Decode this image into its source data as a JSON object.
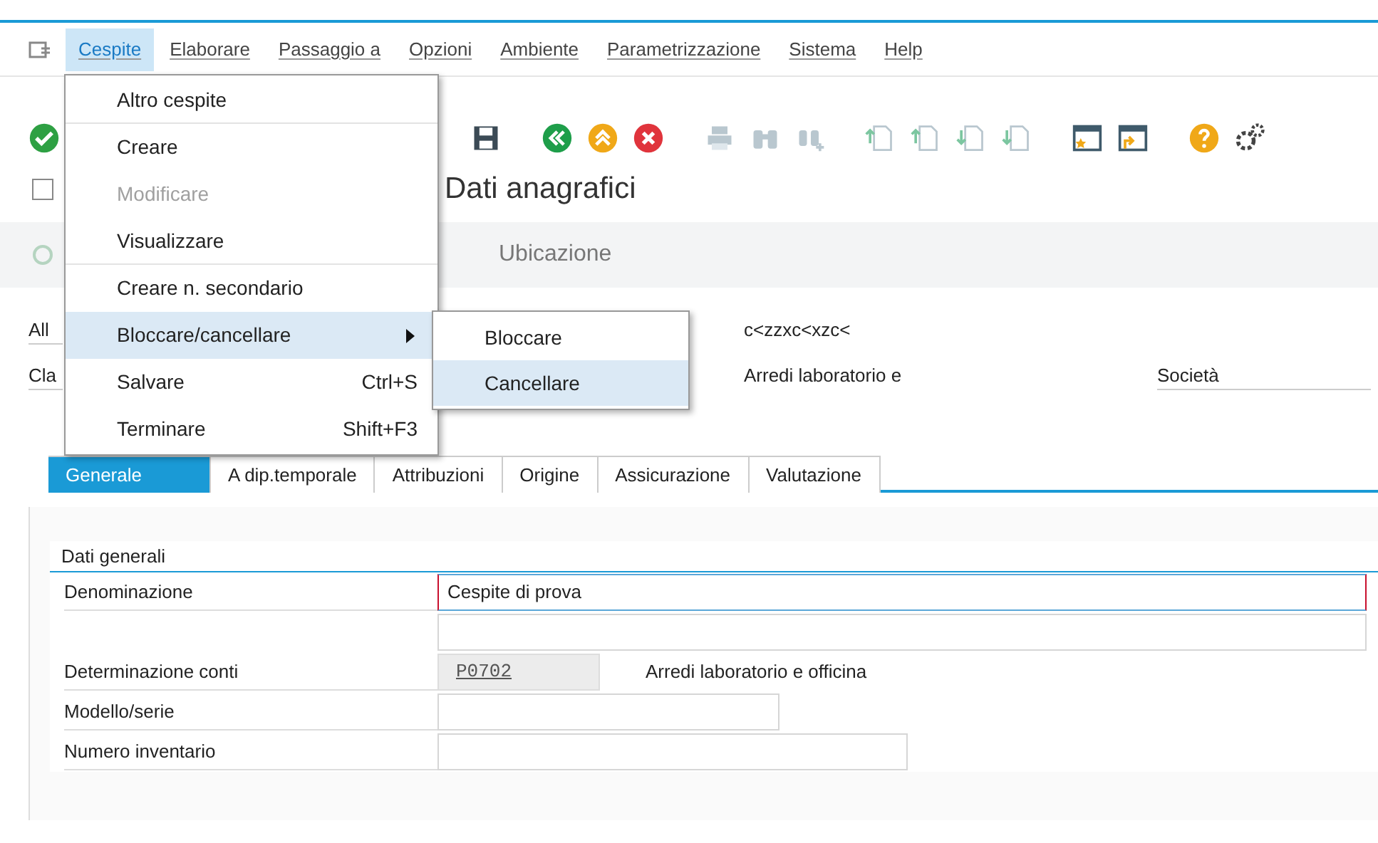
{
  "menubar": [
    {
      "label": "Cespite",
      "selected": true
    },
    {
      "label": "Elaborare",
      "selected": false
    },
    {
      "label": "Passaggio a",
      "selected": false
    },
    {
      "label": "Opzioni",
      "selected": false
    },
    {
      "label": "Ambiente",
      "selected": false
    },
    {
      "label": "Parametrizzazione",
      "selected": false
    },
    {
      "label": "Sistema",
      "selected": false
    },
    {
      "label": "Help",
      "selected": false
    }
  ],
  "menu": {
    "items": [
      {
        "label": "Altro cespite",
        "disabled": false,
        "selected": false,
        "separator_after": true
      },
      {
        "label": "Creare",
        "disabled": false,
        "selected": false,
        "separator_after": false
      },
      {
        "label": "Modificare",
        "disabled": true,
        "selected": false,
        "separator_after": false
      },
      {
        "label": "Visualizzare",
        "disabled": false,
        "selected": false,
        "separator_after": true
      },
      {
        "label": "Creare n. secondario",
        "disabled": false,
        "selected": false,
        "separator_after": false
      },
      {
        "label": "Bloccare/cancellare",
        "disabled": false,
        "selected": true,
        "separator_after": false,
        "submenu": true
      },
      {
        "label": "Salvare",
        "shortcut": "Ctrl+S",
        "disabled": false,
        "selected": false,
        "separator_after": false
      },
      {
        "label": "Terminare",
        "shortcut": "Shift+F3",
        "disabled": false,
        "selected": false,
        "separator_after": false
      }
    ]
  },
  "submenu": {
    "items": [
      {
        "label": "Bloccare",
        "selected": false
      },
      {
        "label": "Cancellare",
        "selected": true
      }
    ]
  },
  "title": "Dati anagrafici",
  "app_toolbar": {
    "button": "Ubicazione"
  },
  "header": {
    "rows": [
      {
        "label": "All",
        "value": "c<zzxc<xzc<"
      },
      {
        "label": "Cla",
        "value": "Arredi laboratorio e",
        "extra_label": "Società"
      }
    ]
  },
  "tabs": [
    {
      "label": "Generale",
      "selected": true
    },
    {
      "label": "A dip.temporale",
      "selected": false
    },
    {
      "label": "Attribuzioni",
      "selected": false
    },
    {
      "label": "Origine",
      "selected": false
    },
    {
      "label": "Assicurazione",
      "selected": false
    },
    {
      "label": "Valutazione",
      "selected": false
    }
  ],
  "group": {
    "title": "Dati generali",
    "rows": [
      {
        "label": "Denominazione",
        "value": "Cespite di prova",
        "focused": true,
        "kind": "wide"
      },
      {
        "kind": "wide",
        "focused": false
      },
      {
        "label": "Determinazione conti",
        "value": "P0702",
        "description": "Arredi laboratorio e officina",
        "kind": "readonly"
      },
      {
        "label": "Modello/serie",
        "kind": "medium",
        "focused": false
      },
      {
        "label": "Numero inventario",
        "kind": "long",
        "focused": false
      }
    ]
  }
}
